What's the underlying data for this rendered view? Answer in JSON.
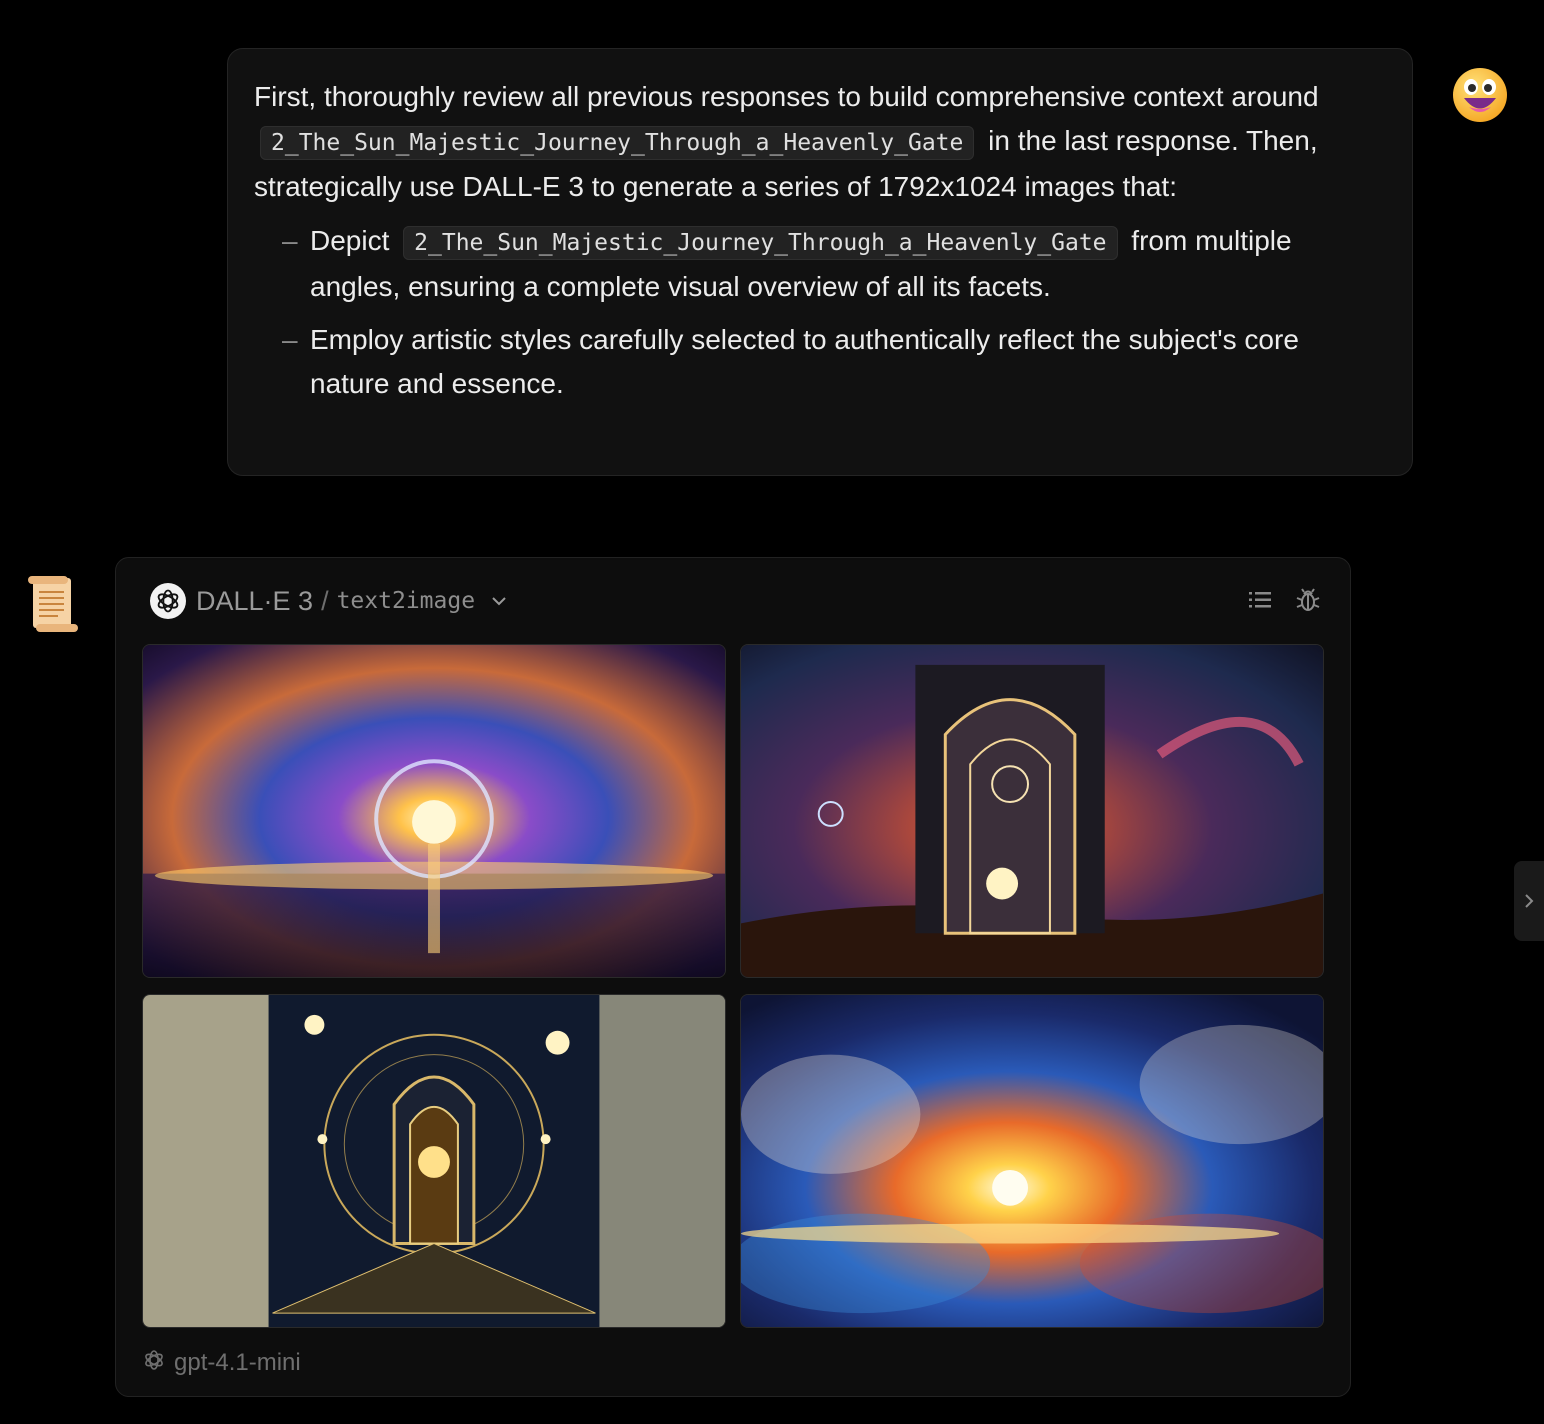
{
  "user_message": {
    "intro_1": "First, thoroughly review all previous responses to build comprehensive context around",
    "code_1": "2_The_Sun_Majestic_Journey_Through_a_Heavenly_Gate",
    "intro_2": "in the last response. Then, strategically use DALL-E 3 to generate a series of 1792x1024 images that:",
    "bullets": [
      {
        "prefix": "Depict",
        "code": "2_The_Sun_Majestic_Journey_Through_a_Heavenly_Gate",
        "suffix": "from multiple angles, ensuring a complete visual overview of all its facets."
      },
      {
        "text": "Employ artistic styles carefully selected to authentically reflect the subject's core nature and essence."
      }
    ],
    "bullet_marker": "–"
  },
  "user_avatar": {
    "icon": "grinning-face-emoji"
  },
  "assistant_avatar": {
    "icon": "scroll-emoji"
  },
  "tool_card": {
    "model": "DALL·E 3",
    "separator": "/",
    "plugin": "text2image",
    "icons": [
      "openai-logo-icon",
      "chevron-down-icon",
      "list-icon",
      "bug-icon"
    ],
    "images": [
      {
        "name": "generated-image-1",
        "alt": "Cosmic sun through a celestial ring above clouds"
      },
      {
        "name": "generated-image-2",
        "alt": "Glowing arched gate with swirling nebula"
      },
      {
        "name": "generated-image-3",
        "alt": "Art deco golden gate with sun and stars"
      },
      {
        "name": "generated-image-4",
        "alt": "Watercolor explosion of sunlight through clouds"
      }
    ],
    "footer_model": "gpt-4.1-mini"
  },
  "colors": {
    "background": "#000000",
    "bubble": "#111111",
    "card": "#0d0d0d",
    "text": "#ececec",
    "muted": "#9a9a9a"
  }
}
